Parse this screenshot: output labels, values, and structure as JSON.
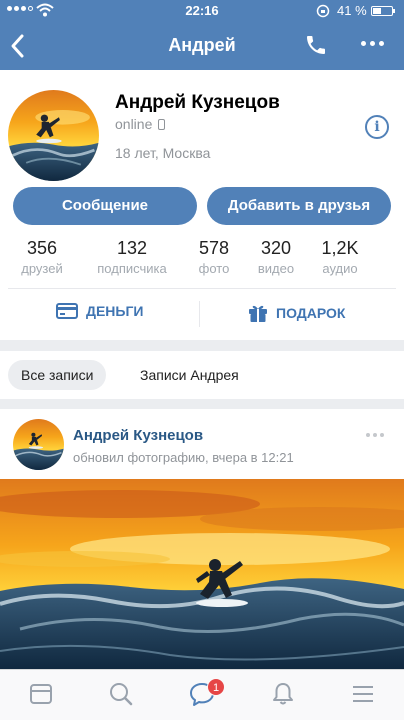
{
  "status_bar": {
    "time": "22:16",
    "battery": "41 %"
  },
  "header": {
    "title": "Андрей"
  },
  "profile": {
    "name": "Андрей Кузнецов",
    "status": "online",
    "info": "18 лет, Москва",
    "message_button": "Сообщение",
    "add_friend_button": "Добавить в друзья",
    "counters": [
      {
        "value": "356",
        "label": "друзей"
      },
      {
        "value": "132",
        "label": "подписчика"
      },
      {
        "value": "578",
        "label": "фото"
      },
      {
        "value": "320",
        "label": "видео"
      },
      {
        "value": "1,2K",
        "label": "аудио"
      }
    ],
    "money_label": "ДЕНЬГИ",
    "gift_label": "ПОДАРОК"
  },
  "filter": {
    "all_posts": "Все записи",
    "own_posts": "Записи Андрея"
  },
  "post": {
    "author": "Андрей Кузнецов",
    "meta": "обновил фотографию, вчера в 12:21"
  },
  "tabbar": {
    "messages_badge": "1"
  },
  "colors": {
    "accent": "#5181b8",
    "link": "#2a5885",
    "badge": "#e64646"
  }
}
